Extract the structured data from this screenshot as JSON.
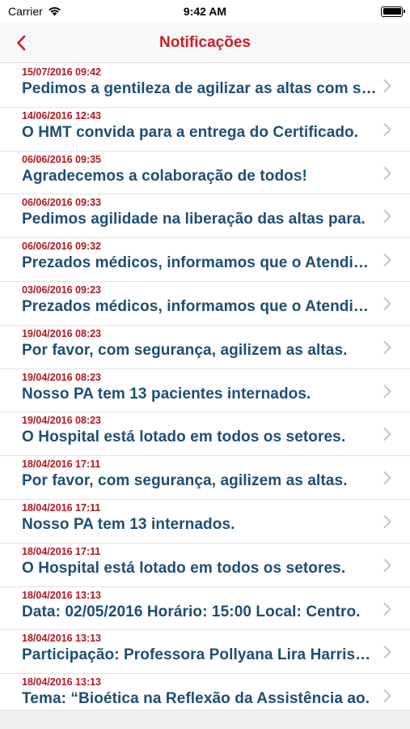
{
  "status": {
    "carrier": "Carrier",
    "time": "9:42 AM"
  },
  "nav": {
    "title": "Notificações"
  },
  "notifications": [
    {
      "date": "15/07/2016 09:42",
      "text": "Pedimos a gentileza de agilizar as altas com segurança."
    },
    {
      "date": "14/06/2016 12:43",
      "text": "O HMT convida para a entrega do Certificado."
    },
    {
      "date": "06/06/2016 09:35",
      "text": "Agradecemos a colaboração de todos!"
    },
    {
      "date": "06/06/2016 09:33",
      "text": "Pedimos agilidade na liberação das altas para."
    },
    {
      "date": "06/06/2016 09:32",
      "text": "Prezados médicos, informamos que o Atendimento."
    },
    {
      "date": "03/06/2016 09:23",
      "text": "Prezados médicos, informamos que o Atendimento."
    },
    {
      "date": "19/04/2016 08:23",
      "text": "Por favor, com segurança, agilizem as altas."
    },
    {
      "date": "19/04/2016 08:23",
      "text": "Nosso PA tem 13 pacientes internados."
    },
    {
      "date": "19/04/2016 08:23",
      "text": "O Hospital está lotado em todos os setores."
    },
    {
      "date": "18/04/2016 17:11",
      "text": "Por favor, com segurança, agilizem as altas."
    },
    {
      "date": "18/04/2016 17:11",
      "text": "Nosso PA tem 13 internados."
    },
    {
      "date": "18/04/2016 17:11",
      "text": "O Hospital está lotado em todos os setores."
    },
    {
      "date": "18/04/2016 13:13",
      "text": "Data: 02/05/2016 Horário: 15:00 Local: Centro."
    },
    {
      "date": "18/04/2016 13:13",
      "text": "Participação: Professora Pollyana Lira Harrison."
    },
    {
      "date": "18/04/2016 13:13",
      "text": "Tema: “Bioética na Reflexão da Assistência ao."
    }
  ]
}
